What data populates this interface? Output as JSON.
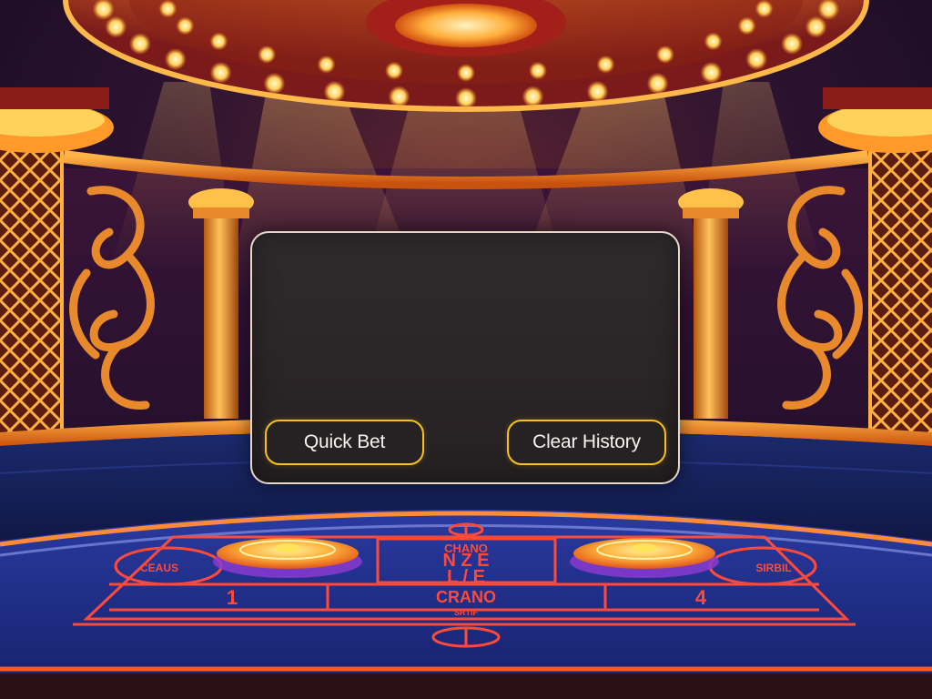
{
  "buttons": {
    "quick_bet": "Quick Bet",
    "clear_history": "Clear History"
  },
  "table_markings": {
    "center_top": "CHANO",
    "center_big_1": "N Z E",
    "center_big_2": "L / E",
    "center_bottom": "CRANO",
    "center_small": "SRTIF",
    "left_number": "1",
    "right_number": "4",
    "left_oval_text": "CEAUS",
    "right_oval_text": "SIRBIL"
  },
  "colors": {
    "accent_gold": "#f4c21b",
    "panel_bg": "#2b2628",
    "table_blue": "#1f2f8a",
    "table_line_red": "#ff4a3a"
  }
}
